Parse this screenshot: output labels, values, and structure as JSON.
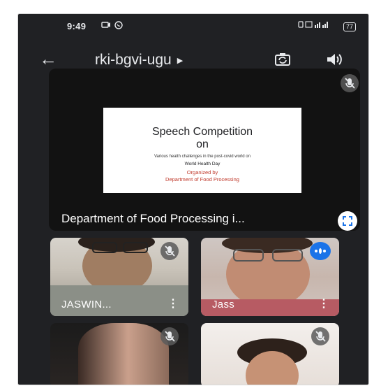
{
  "status_bar": {
    "time": "9:49",
    "battery": "77",
    "signal_text": "  "
  },
  "meeting": {
    "code": "rki-bgvi-ugu"
  },
  "presentation": {
    "label": "Department of Food Processing i...",
    "slide": {
      "line1": "Speech Competition",
      "line2": "on",
      "subtitle": "Various health challenges in the post-covid world on",
      "day": "World Health Day",
      "organized_by": "Organized by",
      "department": "Department of Food Processing"
    }
  },
  "participants": [
    {
      "name": "JASWIN...",
      "muted": true
    },
    {
      "name": "Jass",
      "speaking": true
    },
    {
      "name": "",
      "muted": true
    },
    {
      "name": "",
      "muted": true
    }
  ],
  "icons": {
    "back": "arrow-left-icon",
    "flip_camera": "flip-camera-icon",
    "speaker": "speaker-icon",
    "mic_off": "mic-off-icon",
    "fullscreen": "fullscreen-icon",
    "more": "more-vert-icon"
  },
  "colors": {
    "background": "#202124",
    "accent": "#1a73e8",
    "slide_red": "#c0392b"
  }
}
